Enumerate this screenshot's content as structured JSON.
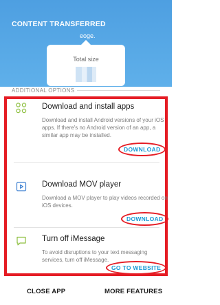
{
  "banner": {
    "title": "CONTENT TRANSFERRED",
    "subtitle": "eoge.",
    "size_label": "Total size",
    "size_value": "",
    "bg_color": "#55a7e6"
  },
  "section": {
    "label": "ADDITIONAL OPTIONS"
  },
  "options": [
    {
      "icon": "apps-grid-icon",
      "title": "Download and install apps",
      "desc": "Download and install Android versions of your iOS apps. If there's no Android version of an app, a similar app may be installed.",
      "action": "DOWNLOAD"
    },
    {
      "icon": "video-player-icon",
      "title": "Download MOV player",
      "desc": "Download a MOV player to play videos recorded on iOS devices.",
      "action": "DOWNLOAD"
    },
    {
      "icon": "message-bubble-icon",
      "title": "Turn off iMessage",
      "desc": "To avoid disruptions to your text messaging services, turn off iMessage.",
      "action": "GO TO WEBSITE"
    }
  ],
  "bottom": {
    "close": "CLOSE APP",
    "more": "MORE FEATURES"
  },
  "colors": {
    "accent": "#1a9ad6",
    "highlight": "#e51c24",
    "icon_green": "#8dbf3f",
    "icon_blue": "#3c7fd1"
  }
}
